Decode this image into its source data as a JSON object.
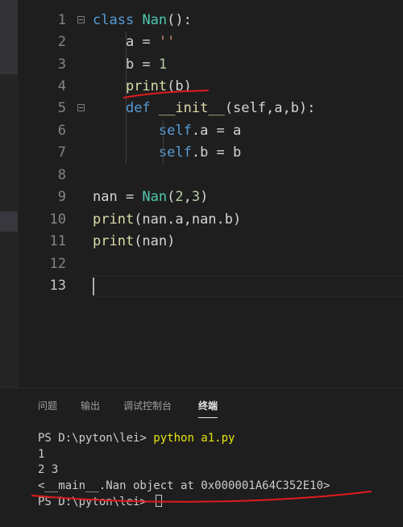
{
  "editor": {
    "line_numbers": [
      "1",
      "2",
      "3",
      "4",
      "5",
      "6",
      "7",
      "8",
      "9",
      "10",
      "11",
      "12",
      "13"
    ],
    "lines": [
      [
        {
          "t": "class",
          "c": "kw"
        },
        {
          "t": " ",
          "c": "txt"
        },
        {
          "t": "Nan",
          "c": "cls"
        },
        {
          "t": "():",
          "c": "txt"
        }
      ],
      [
        {
          "t": "    a = ",
          "c": "txt"
        },
        {
          "t": "''",
          "c": "str"
        }
      ],
      [
        {
          "t": "    b = ",
          "c": "txt"
        },
        {
          "t": "1",
          "c": "num"
        }
      ],
      [
        {
          "t": "    ",
          "c": "txt"
        },
        {
          "t": "print",
          "c": "fn"
        },
        {
          "t": "(b)",
          "c": "txt"
        }
      ],
      [
        {
          "t": "    ",
          "c": "txt"
        },
        {
          "t": "def",
          "c": "kw"
        },
        {
          "t": " ",
          "c": "txt"
        },
        {
          "t": "__init__",
          "c": "fn"
        },
        {
          "t": "(self,a,b):",
          "c": "txt"
        }
      ],
      [
        {
          "t": "        ",
          "c": "txt"
        },
        {
          "t": "self",
          "c": "kw"
        },
        {
          "t": ".a = a",
          "c": "txt"
        }
      ],
      [
        {
          "t": "        ",
          "c": "txt"
        },
        {
          "t": "self",
          "c": "kw"
        },
        {
          "t": ".b = b",
          "c": "txt"
        }
      ],
      [],
      [
        {
          "t": "nan = ",
          "c": "txt"
        },
        {
          "t": "Nan",
          "c": "cls"
        },
        {
          "t": "(",
          "c": "txt"
        },
        {
          "t": "2",
          "c": "num"
        },
        {
          "t": ",",
          "c": "txt"
        },
        {
          "t": "3",
          "c": "num"
        },
        {
          "t": ")",
          "c": "txt"
        }
      ],
      [
        {
          "t": "print",
          "c": "fn"
        },
        {
          "t": "(nan.a,nan.b)",
          "c": "txt"
        }
      ],
      [
        {
          "t": "print",
          "c": "fn"
        },
        {
          "t": "(nan)",
          "c": "txt"
        }
      ],
      [],
      []
    ],
    "active_line": "13"
  },
  "panel": {
    "tabs": [
      "问题",
      "输出",
      "调试控制台",
      "终端"
    ],
    "active_tab": "终端",
    "terminal": {
      "prompt1": "PS D:\\pyton\\lei> ",
      "command": "python a1.py",
      "out1": "1",
      "out2": "2 3",
      "out3": "<__main__.Nan object at 0x000001A64C352E10>",
      "prompt2": "PS D:\\pyton\\lei> "
    }
  },
  "colors": {
    "background": "#1e1e1e",
    "keyword": "#569cd6",
    "class": "#4ec9b0",
    "function": "#dcdcaa",
    "string": "#ce9178",
    "number": "#b5cea8",
    "annotation": "#e01b1b"
  }
}
